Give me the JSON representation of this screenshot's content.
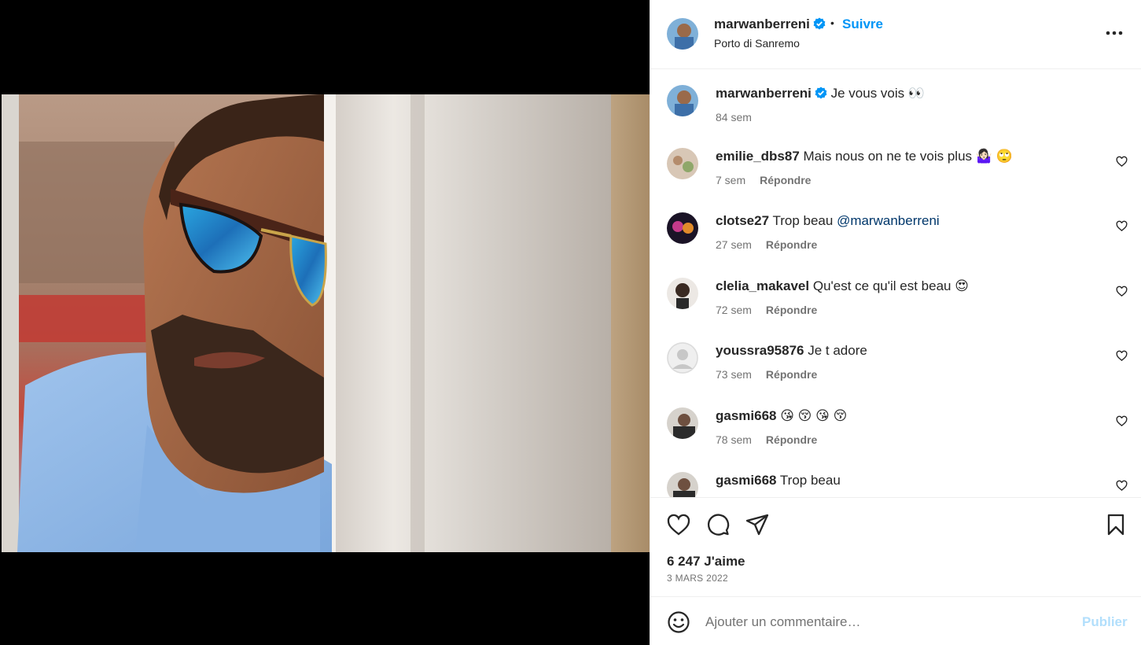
{
  "post": {
    "username": "marwanberreni",
    "separator": "•",
    "follow_label": "Suivre",
    "location": "Porto di Sanremo"
  },
  "caption": {
    "username": "marwanberreni",
    "text": "Je vous vois 👀",
    "time": "84 sem"
  },
  "reply_label": "Répondre",
  "comments": [
    {
      "username": "emilie_dbs87",
      "text": "Mais nous on ne te vois plus 🤷🏻‍♀️ 🙄",
      "time": "7 sem"
    },
    {
      "username": "clotse27",
      "text": "Trop beau ",
      "mention": "@marwanberreni",
      "time": "27 sem"
    },
    {
      "username": "clelia_makavel",
      "text": "Qu'est ce qu'il est beau 😍",
      "time": "72 sem"
    },
    {
      "username": "youssra95876",
      "text": "Je t adore",
      "time": "73 sem"
    },
    {
      "username": "gasmi668",
      "text": "😘 😚 😘 😚",
      "time": "78 sem"
    },
    {
      "username": "gasmi668",
      "text": "Trop beau",
      "time": ""
    }
  ],
  "likes": "6 247 J'aime",
  "date": "3 MARS 2022",
  "comment_box": {
    "placeholder": "Ajouter un commentaire…",
    "publish_label": "Publier"
  },
  "colors": {
    "accent": "#0095f6",
    "publish_disabled": "#b2dffc",
    "mention": "#00376b",
    "muted": "#737373"
  }
}
